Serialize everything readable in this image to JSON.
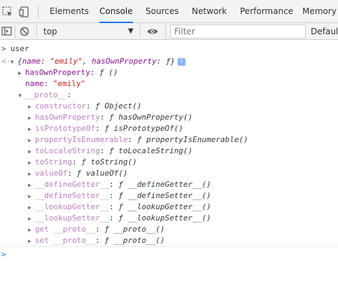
{
  "tabs": {
    "items": [
      "Elements",
      "Console",
      "Sources",
      "Network",
      "Performance",
      "Memory"
    ],
    "active": "Console"
  },
  "toolbar": {
    "context": "top",
    "filter_placeholder": "Filter",
    "levels": "Default"
  },
  "console": {
    "input": "user",
    "result_summary": {
      "open": "{",
      "name_key": "name",
      "name_value": "\"emily\"",
      "sep": ", ",
      "hop_key": "hasOwnProperty",
      "hop_value": "ƒ",
      "close": "}"
    },
    "own": [
      {
        "key": "hasOwnProperty",
        "value": "ƒ ()",
        "expandable": true
      },
      {
        "key": "name",
        "value": "\"emily\"",
        "expandable": false
      }
    ],
    "proto_label": "__proto__",
    "proto_items": [
      {
        "key": "constructor",
        "value": "ƒ Object()"
      },
      {
        "key": "hasOwnProperty",
        "value": "ƒ hasOwnProperty()"
      },
      {
        "key": "isPrototypeOf",
        "value": "ƒ isPrototypeOf()"
      },
      {
        "key": "propertyIsEnumerable",
        "value": "ƒ propertyIsEnumerable()"
      },
      {
        "key": "toLocaleString",
        "value": "ƒ toLocaleString()"
      },
      {
        "key": "toString",
        "value": "ƒ toString()"
      },
      {
        "key": "valueOf",
        "value": "ƒ valueOf()"
      },
      {
        "key": "__defineGetter__",
        "value": "ƒ __defineGetter__()"
      },
      {
        "key": "__defineSetter__",
        "value": "ƒ __defineSetter__()"
      },
      {
        "key": "__lookupGetter__",
        "value": "ƒ __lookupGetter__()"
      },
      {
        "key": "__lookupSetter__",
        "value": "ƒ __lookupSetter__()"
      },
      {
        "key": "get __proto__",
        "value": "ƒ __proto__()"
      },
      {
        "key": "set __proto__",
        "value": "ƒ __proto__()"
      }
    ]
  },
  "colors": {
    "accent": "#1a73e8",
    "key": "#881391",
    "string": "#c41a16"
  }
}
